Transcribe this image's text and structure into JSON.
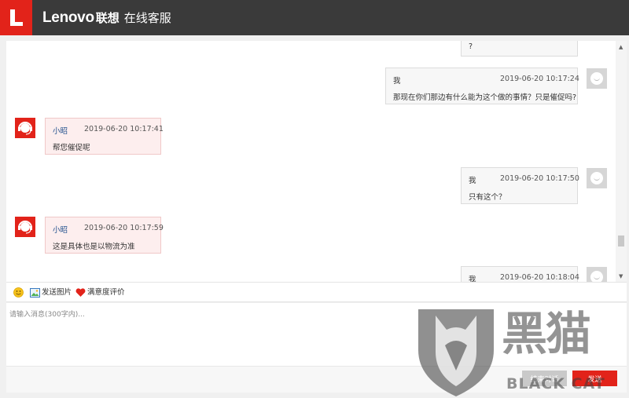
{
  "header": {
    "brand_en": "Lenovo",
    "brand_cn": "联想",
    "subtitle": "在线客服",
    "logo_letter": "L",
    "accent_color": "#e2231a"
  },
  "messages": [
    {
      "role": "user",
      "name": "",
      "time": "",
      "text": "?"
    },
    {
      "role": "user",
      "name": "我",
      "time": "2019-06-20 10:17:24",
      "text": "那现在你们那边有什么能为这个做的事情？只是催促吗?"
    },
    {
      "role": "agent",
      "name": "小昭",
      "time": "2019-06-20 10:17:41",
      "text": "帮您催促呢"
    },
    {
      "role": "user",
      "name": "我",
      "time": "2019-06-20 10:17:50",
      "text": "只有这个？"
    },
    {
      "role": "agent",
      "name": "小昭",
      "time": "2019-06-20 10:17:59",
      "text": "这是具体也是以物流为准"
    },
    {
      "role": "user",
      "name": "我",
      "time": "2019-06-20 10:18:04",
      "text": ""
    }
  ],
  "toolbar": {
    "emoji_icon": "emoji-icon",
    "send_image_label": "发送图片",
    "rating_label": "满意度评价"
  },
  "input": {
    "placeholder": "请输入消息(300字内)..."
  },
  "footer": {
    "end_chat_label": "结束对话",
    "send_label": "发送"
  },
  "watermark": {
    "cn": "黑猫",
    "en": "BLACK CAT"
  }
}
